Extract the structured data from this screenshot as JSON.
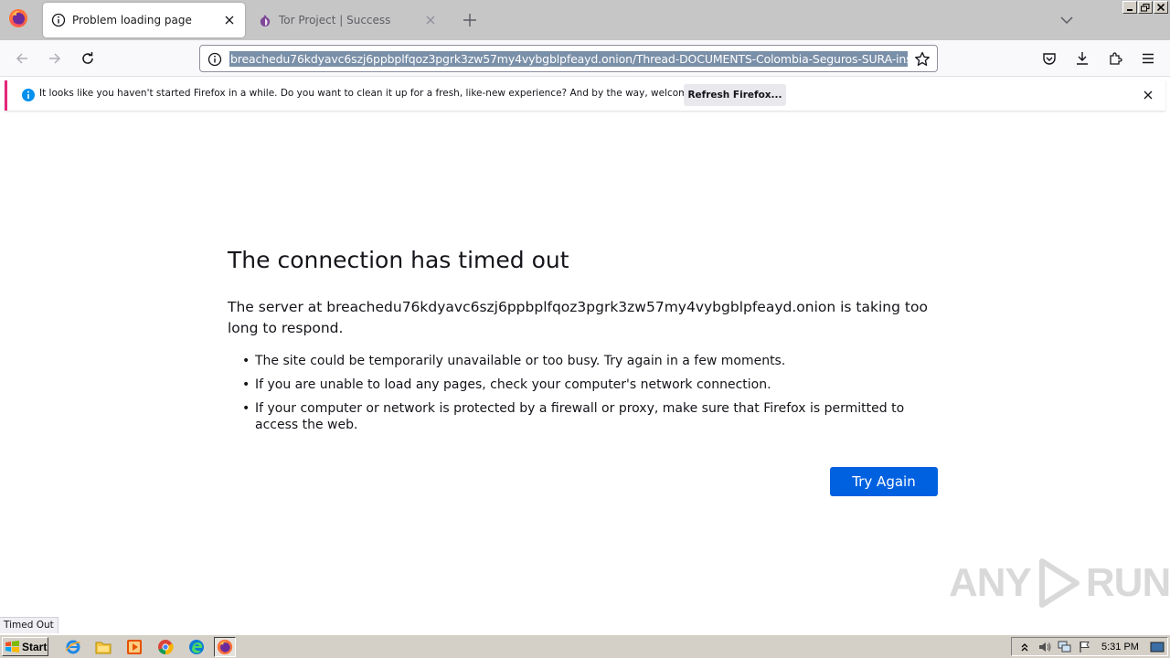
{
  "tabs": [
    {
      "label": "Problem loading page",
      "active": true
    },
    {
      "label": "Tor Project | Success",
      "active": false
    }
  ],
  "url": "breachedu76kdyavc6szj6ppbplfqoz3pgrk3zw57my4vybgblpfeayd.onion/Thread-DOCUMENTS-Colombia-Seguros-SURA-insurance#",
  "notification": {
    "text": "It looks like you haven't started Firefox in a while. Do you want to clean it up for a fresh, like-new experience? And by the way, welcome back!",
    "button_label": "Refresh Firefox..."
  },
  "error": {
    "title": "The connection has timed out",
    "description": "The server at breachedu76kdyavc6szj6ppbplfqoz3pgrk3zw57my4vybgblpfeayd.onion is taking too long to respond.",
    "items": [
      "The site could be temporarily unavailable or too busy. Try again in a few moments.",
      "If you are unable to load any pages, check your computer's network connection.",
      "If your computer or network is protected by a firewall or proxy, make sure that Firefox is permitted to access the web."
    ],
    "button_label": "Try Again"
  },
  "status_text": "Timed Out",
  "watermark": "ANY RUN",
  "taskbar": {
    "start_label": "Start",
    "apps": [
      "internet-explorer-icon",
      "file-explorer-icon",
      "media-player-icon",
      "chrome-icon",
      "edge-icon",
      "firefox-icon"
    ],
    "clock": "5:31 PM"
  },
  "colors": {
    "accent_blue": "#0061e0",
    "notification_accent": "#e6267a",
    "url_selection": "#7a8fa8"
  }
}
